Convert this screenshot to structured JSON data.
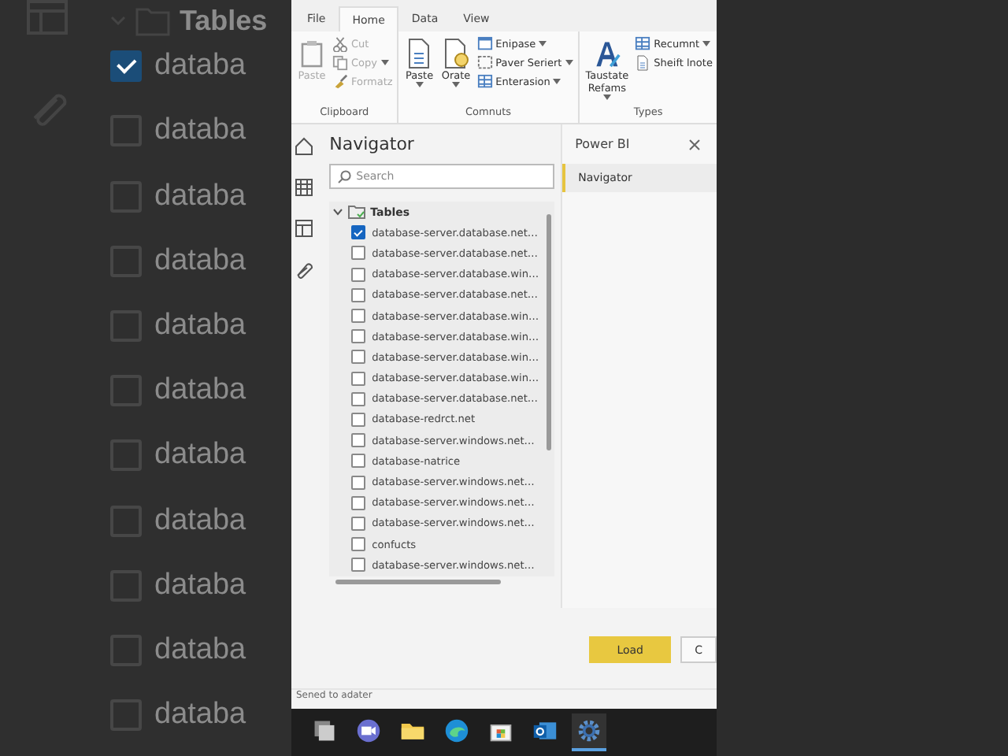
{
  "backdrop": {
    "heading": "Tables",
    "items": [
      {
        "label": "databa",
        "checked": true
      },
      {
        "label": "databa",
        "checked": false
      },
      {
        "label": "databa",
        "checked": false
      },
      {
        "label": "databa",
        "checked": false
      },
      {
        "label": "databa",
        "checked": false
      },
      {
        "label": "databa",
        "checked": false
      },
      {
        "label": "databa",
        "checked": false
      },
      {
        "label": "databa",
        "checked": false
      },
      {
        "label": "databa",
        "checked": false
      },
      {
        "label": "databa",
        "checked": false
      },
      {
        "label": "databa",
        "checked": false
      }
    ]
  },
  "ribbon_tabs": [
    {
      "label": "File",
      "selected": false
    },
    {
      "label": "Home",
      "selected": true
    },
    {
      "label": "Data",
      "selected": false
    },
    {
      "label": "View",
      "selected": false
    }
  ],
  "ribbon_groups": [
    {
      "title": "Clipboard",
      "large": [
        {
          "label": "Paste",
          "caret": false,
          "disabled": true
        }
      ],
      "small": [
        {
          "label": "Cut",
          "caret": false,
          "disabled": true
        },
        {
          "label": "Copy",
          "caret": true,
          "disabled": true
        },
        {
          "label": "Formatz",
          "caret": false,
          "disabled": true
        }
      ]
    },
    {
      "title": "Comnuts",
      "large": [
        {
          "label": "Paste",
          "caret": true,
          "disabled": false
        },
        {
          "label": "Orate",
          "caret": true,
          "disabled": false
        }
      ],
      "small": [
        {
          "label": "Enipase",
          "caret": true,
          "disabled": false
        },
        {
          "label": "Paver Seriert",
          "caret": true,
          "disabled": false
        },
        {
          "label": "Enterasion",
          "caret": true,
          "disabled": false
        }
      ]
    },
    {
      "title": "Types",
      "large": [
        {
          "label": "Taustate Refams",
          "caret": true,
          "disabled": false
        }
      ],
      "small": [
        {
          "label": "Recumnt",
          "caret": true,
          "disabled": false
        },
        {
          "label": "Sheift lnote",
          "caret": false,
          "disabled": false
        }
      ]
    }
  ],
  "navigator": {
    "title": "Navigator",
    "search": {
      "placeholder": "Search"
    },
    "tree": {
      "label": "Tables",
      "expanded": true,
      "children": [
        {
          "label": "database-server.database.net…",
          "checked": true
        },
        {
          "label": "database-server.database.net…",
          "checked": false
        },
        {
          "label": "database-server.database.win…",
          "checked": false
        },
        {
          "label": "database-server.database.net…",
          "checked": false
        },
        {
          "label": "database-server.database.win…",
          "checked": false
        },
        {
          "label": "database-server.database.win…",
          "checked": false
        },
        {
          "label": "database-server.database.win…",
          "checked": false
        },
        {
          "label": "database-server.database.win…",
          "checked": false
        },
        {
          "label": "database-server.database.net…",
          "checked": false
        },
        {
          "label": "database-redrct.net",
          "checked": false
        },
        {
          "label": "database-server.windows.net…",
          "checked": false
        },
        {
          "label": "database-natrice",
          "checked": false
        },
        {
          "label": "database-server.windows.net…",
          "checked": false
        },
        {
          "label": "database-server.windows.net…",
          "checked": false
        },
        {
          "label": "database-server.windows.net…",
          "checked": false
        },
        {
          "label": "confucts",
          "checked": false
        },
        {
          "label": "database-server.windows.net…",
          "checked": false
        }
      ]
    }
  },
  "side_pane": {
    "title": "Power BI",
    "items": [
      {
        "label": "Navigator",
        "selected": true
      }
    ]
  },
  "buttons": [
    {
      "label": "Load",
      "kind": "primary"
    },
    {
      "label": "C",
      "kind": "secondary"
    }
  ],
  "status_bar": "Sened to adater",
  "taskbar": [
    {
      "active": false
    },
    {
      "active": false
    },
    {
      "active": false
    },
    {
      "active": false
    },
    {
      "active": false
    },
    {
      "active": false
    },
    {
      "active": true
    }
  ]
}
